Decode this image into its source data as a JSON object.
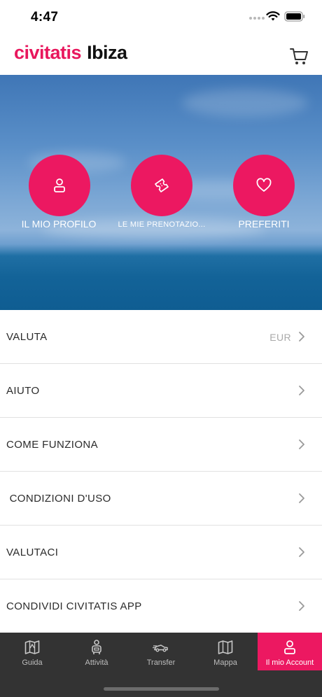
{
  "status_bar": {
    "time": "4:47"
  },
  "header": {
    "brand_logo": "civitatis",
    "brand_city": "Ibiza",
    "cart_icon": "cart-icon"
  },
  "hero": {
    "buttons": [
      {
        "label": "IL MIO PROFILO",
        "icon": "user-icon"
      },
      {
        "label": "LE MIE PRENOTAZIO...",
        "icon": "ticket-icon"
      },
      {
        "label": "PREFERITI",
        "icon": "heart-icon"
      }
    ]
  },
  "menu": {
    "items": [
      {
        "label": "VALUTA",
        "value": "EUR"
      },
      {
        "label": "AIUTO"
      },
      {
        "label": "COME FUNZIONA"
      },
      {
        "label": " CONDIZIONI D'USO"
      },
      {
        "label": "VALUTACI"
      },
      {
        "label": "CONDIVIDI CIVITATIS APP"
      }
    ]
  },
  "tab_bar": {
    "active": "Il mio Account",
    "tabs": [
      {
        "label": "Guida",
        "icon": "map-guide-icon"
      },
      {
        "label": "Attività",
        "icon": "traveler-icon"
      },
      {
        "label": "Transfer",
        "icon": "car-icon"
      },
      {
        "label": "Mappa",
        "icon": "map-icon"
      },
      {
        "label": "Il mio Account",
        "icon": "user-icon"
      }
    ]
  },
  "colors": {
    "brand": "#e8175d",
    "button": "#ec1861",
    "tab_bar": "#333333",
    "divider": "#e1e1e1"
  }
}
